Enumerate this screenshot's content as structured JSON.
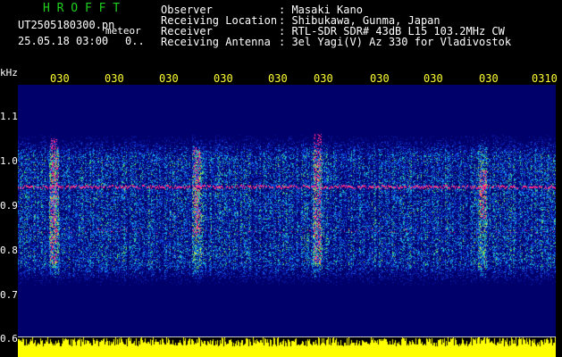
{
  "header": {
    "program": "H R O F F T",
    "filename": "UT2505180300.pn",
    "meteor_label": "meteor",
    "datetime": "25.05.18 03:00",
    "datetime_suffix": "0..",
    "fields": [
      {
        "label": "Observer",
        "value": ": Masaki Kano"
      },
      {
        "label": "Receiving Location",
        "value": ": Shibukawa, Gunma, Japan"
      },
      {
        "label": "Receiver",
        "value": ": RTL-SDR SDR# 43dB L15 103.2MHz CW"
      },
      {
        "label": "Receiving Antenna",
        "value": ": 3el Yagi(V) Az 330 for Vladivostok"
      }
    ]
  },
  "axis": {
    "unit": "kHz",
    "freq_ticks": [
      "1.1",
      "1.0",
      "0.9",
      "0.8",
      "0.7",
      "0.6"
    ],
    "time_ticks": [
      "030",
      "030",
      "030",
      "030",
      "030",
      "030",
      "030",
      "030",
      "030",
      "0310"
    ]
  },
  "colors": {
    "header_text": "#ffffff",
    "program_title": "#1fd01f",
    "time_ticks": "#ffff33",
    "spectrogram_bg": "#00006a",
    "signal_line": "#ff2a8a",
    "level_bars": "#ffff00"
  }
}
